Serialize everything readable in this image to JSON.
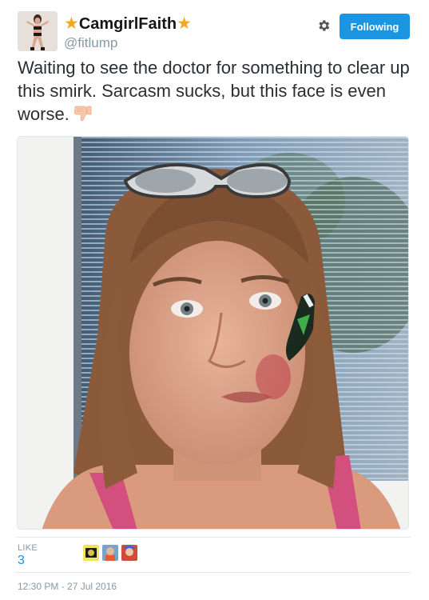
{
  "tweet": {
    "author": {
      "star_left": "★",
      "display_name": "CamgirlFaith",
      "star_right": "★",
      "handle": "@fitlump",
      "avatar_icon": "profile-photo"
    },
    "follow_label": "Following",
    "settings_icon": "gear-icon",
    "text": "Waiting to see the doctor for something to clear up this smirk.  Sarcasm sucks, but this face is even worse.",
    "emoji": "thumbs-down-icon",
    "like_label": "LIKE",
    "like_count": "3",
    "timestamp": "12:30 PM - 27 Jul 2016",
    "colors": {
      "accent": "#1b95e0",
      "star": "#f5a623",
      "muted": "#8899a6"
    }
  }
}
